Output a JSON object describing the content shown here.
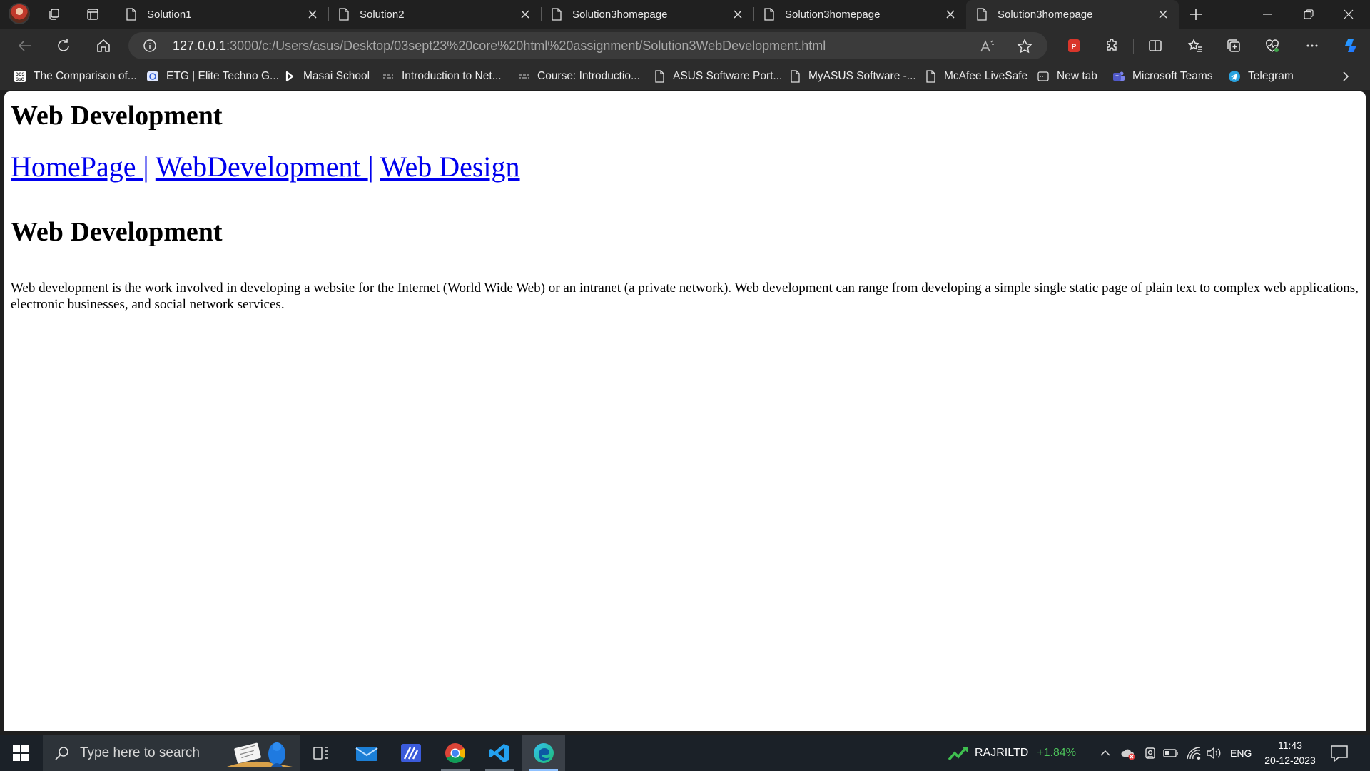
{
  "browser": {
    "tabs": [
      {
        "title": "Solution1",
        "active": false
      },
      {
        "title": "Solution2",
        "active": false
      },
      {
        "title": "Solution3homepage",
        "active": false
      },
      {
        "title": "Solution3homepage",
        "active": false
      },
      {
        "title": "Solution3homepage",
        "active": true
      }
    ],
    "address": {
      "host": "127.0.0.1",
      "path": ":3000/c:/Users/asus/Desktop/03sept23%20core%20html%20assignment/Solution3WebDevelopment.html"
    },
    "favorites": [
      {
        "label": "The Comparison of...",
        "icon": "dcs-site-icon"
      },
      {
        "label": "ETG | Elite Techno G...",
        "icon": "etg-site-icon"
      },
      {
        "label": "Masai School",
        "icon": "masai-site-icon"
      },
      {
        "label": "Introduction to Net...",
        "icon": "course-site-icon"
      },
      {
        "label": "Course: Introductio...",
        "icon": "course-site-icon"
      },
      {
        "label": "ASUS Software Port...",
        "icon": "page-icon"
      },
      {
        "label": "MyASUS Software -...",
        "icon": "page-icon"
      },
      {
        "label": "McAfee LiveSafe",
        "icon": "page-icon"
      },
      {
        "label": "New tab",
        "icon": "new-tab-icon"
      },
      {
        "label": "Microsoft Teams",
        "icon": "teams-icon"
      },
      {
        "label": "Telegram",
        "icon": "telegram-icon"
      }
    ]
  },
  "page": {
    "heading1": "Web Development",
    "nav": {
      "home": "HomePage ",
      "webdev": "WebDevelopment ",
      "design": "Web Design",
      "separator": "|"
    },
    "heading2": "Web Development",
    "paragraph": "Web development is the work involved in developing a website for the Internet (World Wide Web) or an intranet (a private network). Web development can range from developing a simple single static page of plain text to complex web applications, electronic businesses, and social network services."
  },
  "taskbar": {
    "search_placeholder": "Type here to search",
    "stock": {
      "ticker": "RAJRILTD",
      "change": "+1.84%",
      "change_color": "#4cc35a"
    },
    "language": "ENG",
    "time": "11:43",
    "date": "20-12-2023"
  },
  "colors": {
    "link": "#0000ee",
    "chrome_dark": "#202020",
    "toolbar": "#2c2c2c",
    "taskbar": "#1b2128"
  }
}
